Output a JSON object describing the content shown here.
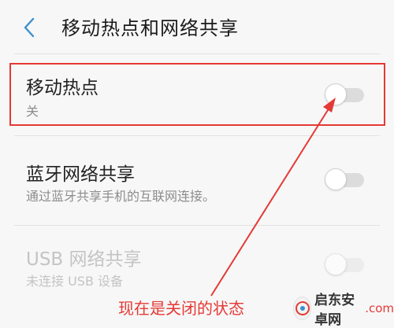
{
  "header": {
    "back_icon": "chevron-left-icon",
    "title": "移动热点和网络共享"
  },
  "rows": [
    {
      "title": "移动热点",
      "subtitle": "关",
      "toggle_on": false,
      "enabled": true
    },
    {
      "title": "蓝牙网络共享",
      "subtitle": "通过蓝牙共享手机的互联网连接。",
      "toggle_on": false,
      "enabled": true
    },
    {
      "title": "USB 网络共享",
      "subtitle": "未连接 USB 设备",
      "toggle_on": false,
      "enabled": false
    }
  ],
  "annotation": {
    "text": "现在是关闭的状态",
    "color": "#e53935"
  },
  "watermark": {
    "name": "启东安卓网",
    "domain": ".com"
  },
  "colors": {
    "accent": "#3a8fd0",
    "annotation": "#e53935",
    "background": "#f7f7f7"
  }
}
